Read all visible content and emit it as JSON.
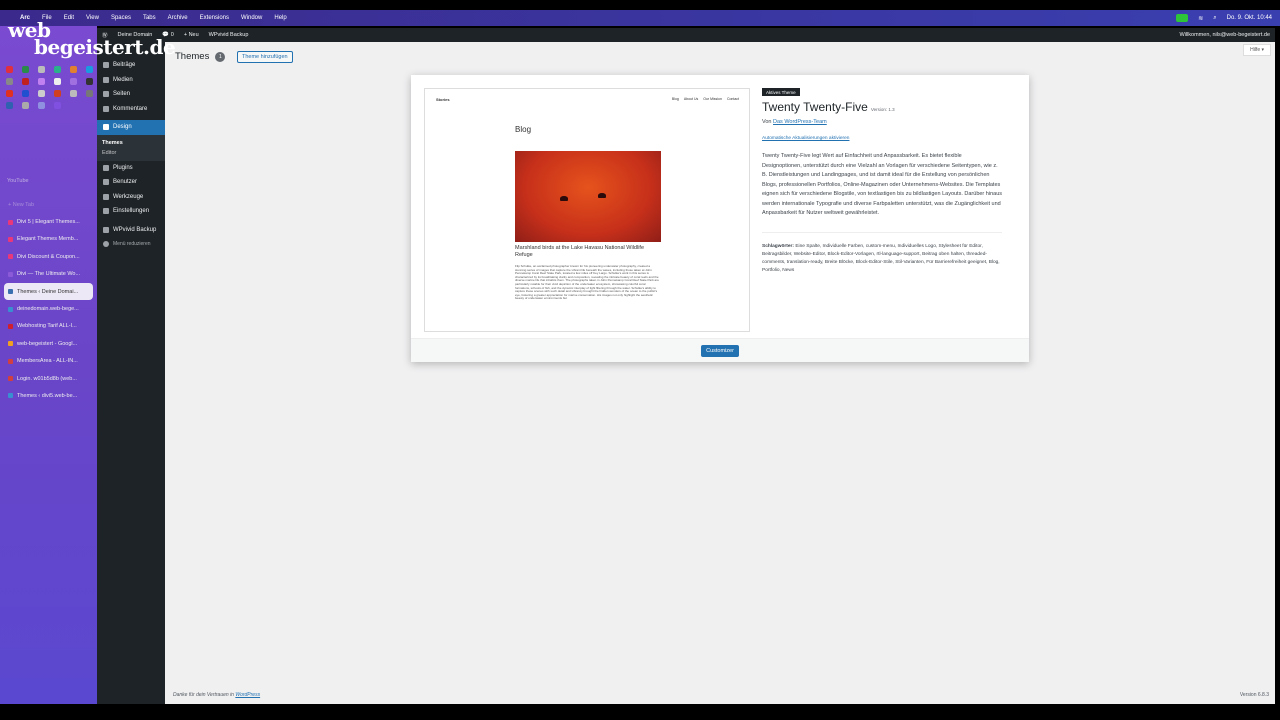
{
  "menubar": {
    "app": "Arc",
    "items": [
      "File",
      "Edit",
      "View",
      "Spaces",
      "Tabs",
      "Archive",
      "Extensions",
      "Window",
      "Help"
    ],
    "clock": "Do. 9. Okt. 10:44"
  },
  "logo": {
    "line1": "web",
    "line2": "begeistert.de"
  },
  "arc": {
    "youtube": "YouTube",
    "new_tab": "+ New Tab",
    "tabs": [
      {
        "label": "Divi 5 | Elegant Themes...",
        "color": "#e8387a"
      },
      {
        "label": "Elegant Themes Memb...",
        "color": "#e8387a"
      },
      {
        "label": "Divi Discount & Coupon...",
        "color": "#e8387a"
      },
      {
        "label": "Divi — The Ultimate Wo...",
        "color": "#8a5ad8"
      },
      {
        "label": "Themes ‹ Deine Domai...",
        "color": "#3a6fb0"
      },
      {
        "label": "deinedomain.web-bege...",
        "color": "#3a8fd0"
      },
      {
        "label": "Webhosting Tarif ALL-I...",
        "color": "#d02030"
      },
      {
        "label": "web-begeistert - Googl...",
        "color": "#f0a020"
      },
      {
        "label": "MembersArea - ALL-IN...",
        "color": "#d04040"
      },
      {
        "label": "Login. w01b5d8b (web...",
        "color": "#d04040"
      },
      {
        "label": "Themes ‹ divi5.web-be...",
        "color": "#3a8fd0"
      }
    ]
  },
  "adminbar": {
    "site": "Deine Domain",
    "comments": "0",
    "new": "+ Neu",
    "backup": "WPvivid Backup",
    "greeting": "Willkommen, nils@web-begeistert.de"
  },
  "adminmenu": {
    "items": [
      "Beiträge",
      "Medien",
      "Seiten",
      "Kommentare"
    ],
    "current": "Design",
    "sub": [
      "Themes",
      "Editor"
    ],
    "items2": [
      "Plugins",
      "Benutzer",
      "Werkzeuge",
      "Einstellungen"
    ],
    "backup": "WPvivid Backup",
    "collapse": "Menü reduzieren"
  },
  "page": {
    "title": "Themes",
    "count": "1",
    "add_button": "Theme hinzufügen",
    "help": "Hilfe ▾"
  },
  "preview": {
    "site": "Stories",
    "nav": [
      "Blog",
      "About Us",
      "Our Mission",
      "Contact"
    ],
    "heading": "Blog",
    "post_title": "Marshland birds at the Lake Havasu National Wildlife Refuge",
    "excerpt": "Flip Schulke, an acclaimed photographer known for his pioneering underwater photography, created a stunning series of images that capture the vibrant life beneath the waves, including those taken at John Pennekamp Coral Reef State Park, located a few miles off Key Largo. Schulke's work in this series is characterized by its breathtaking clarity and composition, revealing the intricate beauty of coral reefs and the diverse marine life that inhabits them. The photographs taken in John Pennekamp Coral Reef State Park are particularly notable for their vivid depiction of the underwater ecosystem, showcasing colorful coral formations, schools of fish, and the dynamic interplay of light filtering through the water. Schulke's ability to capture these scenes with such detail and vibrancy brought the hidden wonders of the ocean to the public's eye, fostering a greater appreciation for marine conservation. His images not only highlight the aesthetic beauty of underwater environments but"
  },
  "theme": {
    "active_label": "Aktives Theme",
    "name": "Twenty Twenty-Five",
    "version": "Version: 1.3",
    "by": "Von",
    "author": "Das WordPress-Team",
    "auto_update": "Automatische Aktualisierungen aktivieren",
    "description": "Twenty Twenty-Five legt Wert auf Einfachheit und Anpassbarkeit. Es bietet flexible Designoptionen, unterstützt durch eine Vielzahl an Vorlagen für verschiedene Seitentypen, wie z. B. Dienstleistungen und Landingpages, und ist damit ideal für die Erstellung von persönlichen Blogs, professionellen Portfolios, Online-Magazinen oder Unternehmens-Websites. Die Templates eignen sich für verschiedene Blogstile, von textlastigen bis zu bildlastigen Layouts. Darüber hinaus werden internationale Typografie und diverse Farbpaletten unterstützt, was die Zugänglichkeit und Anpassbarkeit für Nutzer weltweit gewährleistet.",
    "tags_label": "Schlagwörter:",
    "tags": "Eine Spalte, Individuelle Farben, custom-menu, Individuelles Logo, Stylesheet für Editor, Beitragsbilder, Website-Editor, Block-Editor-Vorlagen, rtl-language-support, Beitrag oben halten, threaded-comments, translation-ready, Breite Blöcke, Block-Editor-Stile, Stil-Varianten, Für Barrierefreiheit geeignet, Blog, Portfolio, News",
    "customize": "Customizer"
  },
  "footer": {
    "thanks": "Danke für dein Vertrauen in",
    "wp_link": "WordPress",
    "version": "Version 6.8.3"
  }
}
